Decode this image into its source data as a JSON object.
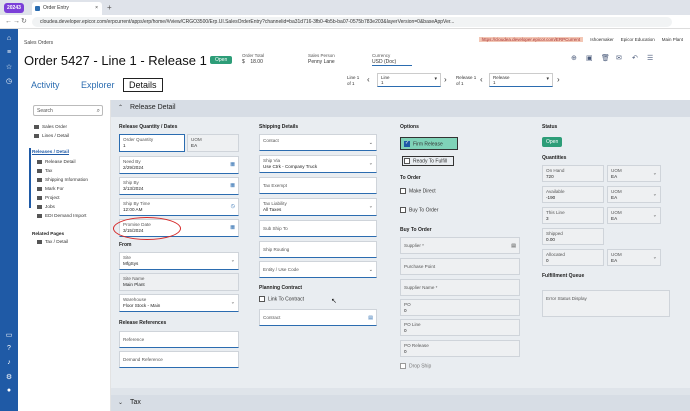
{
  "browser": {
    "tab_group": "20243",
    "tab_title": "Order Entry",
    "tab_close": "×",
    "new_tab": "+",
    "url": "cloudea.developer.epicor.com/erpcurrent/apps/erp/home/#/view/CRGO3500/Erp.UI.SalesOrderEntry?channelid=ba31d716-3fb0-4b5b-ba07-0575b783e203&layerVersion=0&baseAppVer...",
    "bookmarks": [
      "https://cloudea.developer.epicor.com/ERPCurrent",
      "Ishoemaker",
      "Epicor Education",
      "Main Plant"
    ]
  },
  "header": {
    "breadcrumb": "Sales Orders",
    "title": "Order 5427 - Line 1 - Release 1",
    "status": "Open",
    "order_total_label": "Order Total",
    "order_total_currency": "$",
    "order_total_value": "18.00",
    "sales_person_label": "Sales Person",
    "sales_person_value": "Penny Lane",
    "currency_label": "Currency",
    "currency_value": "USD (Doc)"
  },
  "tabs": [
    "Activity",
    "Explorer",
    "Details"
  ],
  "pager": {
    "line_label": "Line 1",
    "line_of": "of 1",
    "line_select_label": "Line",
    "line_select_value": "1",
    "release_label": "Release 1",
    "release_of": "of 1",
    "release_select_label": "Release",
    "release_select_value": "1"
  },
  "sidebar": {
    "search_placeholder": "Search",
    "items": [
      {
        "label": "Sales Order",
        "level": 0
      },
      {
        "label": "Lines / Detail",
        "level": 0
      },
      {
        "label": "Releases / Detail",
        "level": 0,
        "active": true
      },
      {
        "label": "Release Detail",
        "level": 1
      },
      {
        "label": "Tax",
        "level": 1
      },
      {
        "label": "Shipping Information",
        "level": 1
      },
      {
        "label": "Mark For",
        "level": 1
      },
      {
        "label": "Project",
        "level": 1
      },
      {
        "label": "Jobs",
        "level": 1
      },
      {
        "label": "EDI Demand Import",
        "level": 1
      }
    ],
    "related_heading": "Related Pages",
    "related": [
      {
        "label": "Tax / Detail"
      }
    ]
  },
  "section": {
    "title": "Release Detail",
    "tax_title": "Tax"
  },
  "col1": {
    "group_qty": "Release Quantity / Dates",
    "order_qty_label": "Order Quantity",
    "order_qty_value": "1",
    "uom_label": "UOM",
    "uom_value": "EA",
    "need_by_label": "Need By",
    "need_by_value": "2/29/2024",
    "ship_by_label": "Ship By",
    "ship_by_value": "3/13/2024",
    "ship_by_time_label": "Ship By Time",
    "ship_by_time_value": "12:00 AM",
    "promise_label": "Promise Date",
    "promise_value": "3/15/2024",
    "group_from": "From",
    "site_label": "Site",
    "site_value": "MfgSys",
    "site_name_label": "Site Name",
    "site_name_value": "Main Plant",
    "warehouse_label": "Warehouse",
    "warehouse_value": "Floor Stock - Main",
    "group_refs": "Release References",
    "reference": "Reference",
    "demand_reference": "Demand Reference"
  },
  "col2": {
    "group_shipping": "Shipping Details",
    "contact": "Contact",
    "ship_via_label": "Ship Via",
    "ship_via_value": "Use Ctrk - Company Truck",
    "tax_exempt": "Tax Exempt",
    "tax_liability_label": "Tax Liability",
    "tax_liability_value": "All Taxes",
    "sub_ship_to": "Sub Ship To",
    "ship_routing": "Ship Routing",
    "entity_use_code": "Entity / Use Code",
    "group_planning": "Planning Contract",
    "link_to_contract": "Link To Contract",
    "contract": "Contract"
  },
  "col3": {
    "group_options": "Options",
    "firm_release": "Firm Release",
    "ready_to_fulfill": "Ready To Fulfill",
    "group_to_order": "To Order",
    "make_direct": "Make Direct",
    "buy_to_order": "Buy To Order",
    "group_buy": "Buy To Order",
    "supplier": "Supplier *",
    "purchase_point": "Purchase Point",
    "supplier_name": "Supplier Name *",
    "po_label": "PO",
    "po_value": "0",
    "po_line_label": "PO Line",
    "po_line_value": "0",
    "po_release_label": "PO Release",
    "po_release_value": "0",
    "drop_ship": "Drop Ship"
  },
  "col4": {
    "group_status": "Status",
    "status_value": "Open",
    "group_quantities": "Quantities",
    "on_hand_label": "On Hand",
    "on_hand_value": "720",
    "available_label": "Available",
    "available_value": "-190",
    "this_line_label": "This Line",
    "this_line_value": "3",
    "shipped_label": "Shipped",
    "shipped_value": "0.00",
    "allocated_label": "Allocated",
    "allocated_value": "0",
    "uom_label": "UOM",
    "uom_value": "EA",
    "group_fulfillment": "Fulfillment Queue",
    "error_status": "Error Status Display"
  },
  "colors": {
    "rail": "#1f5aa6",
    "accent": "#2b6cb0",
    "status_green": "#2d9d78",
    "firm_highlight": "#7fd3b8",
    "annotation": "#d62828"
  }
}
